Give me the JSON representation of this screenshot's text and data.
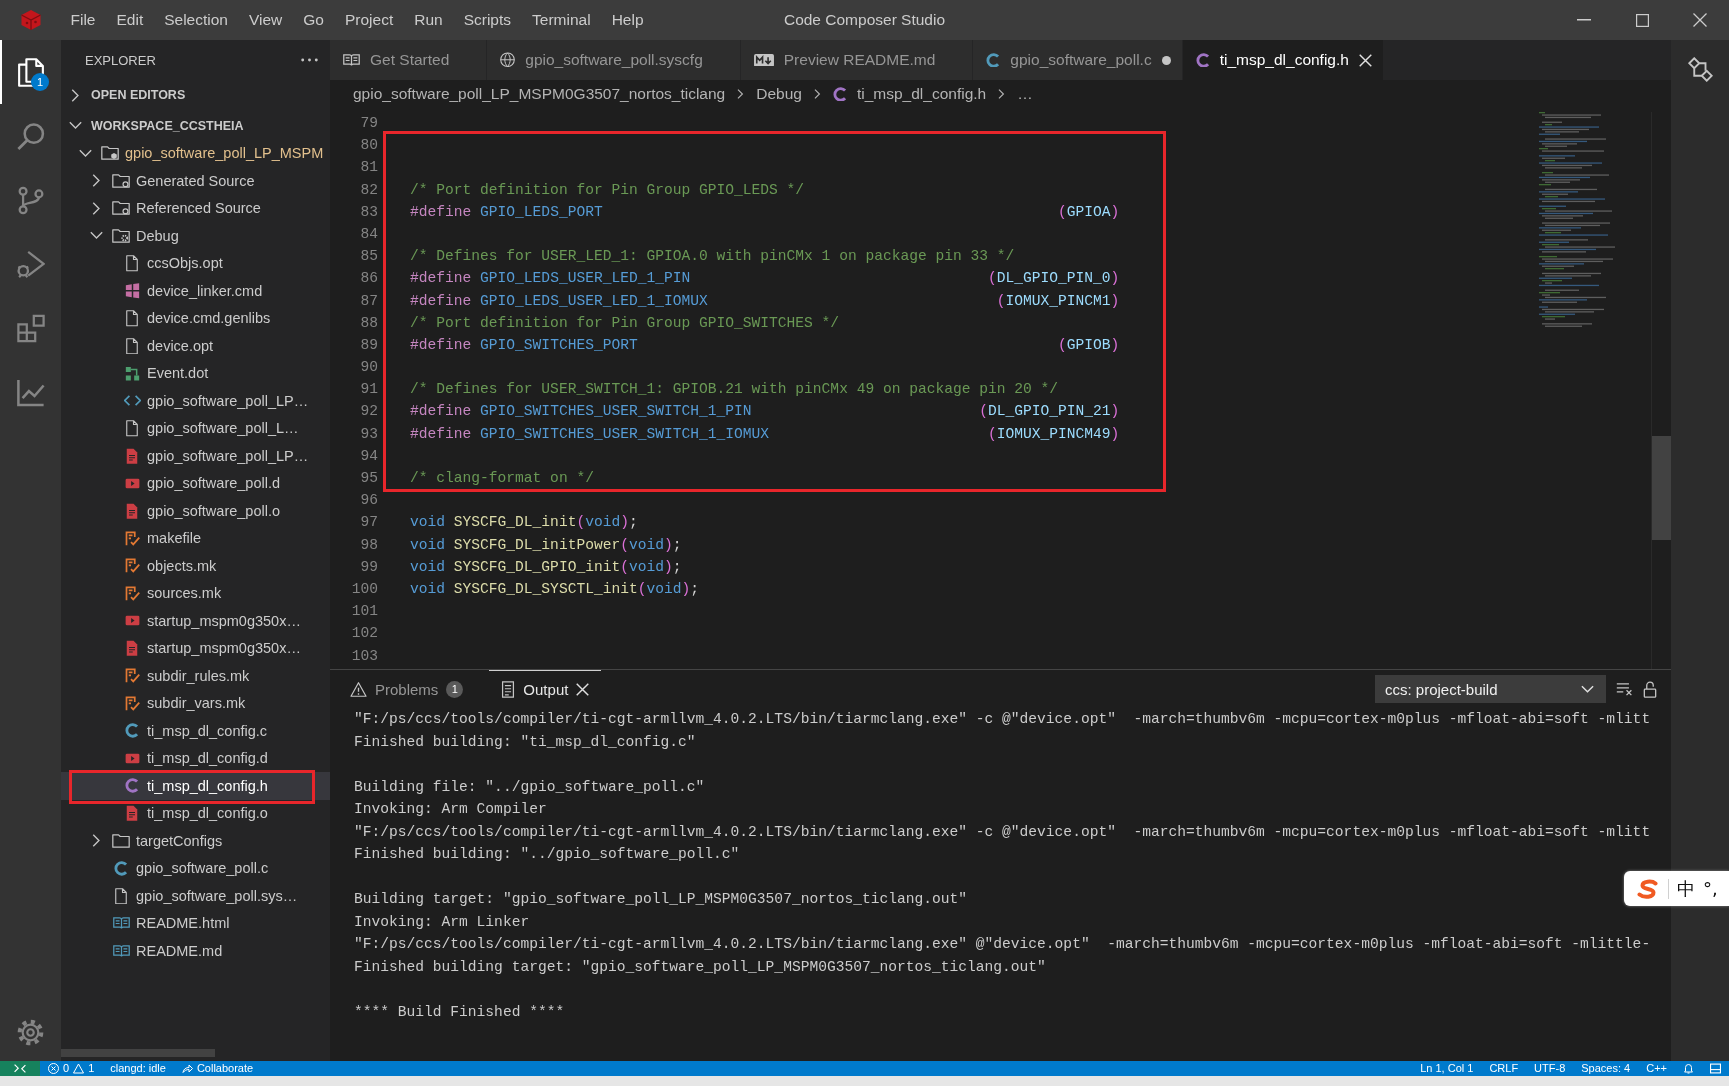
{
  "title_bar": {
    "menu": [
      "File",
      "Edit",
      "Selection",
      "View",
      "Go",
      "Project",
      "Run",
      "Scripts",
      "Terminal",
      "Help"
    ],
    "title": "Code Composer Studio"
  },
  "activity_bar": {
    "items": [
      {
        "kind": "explorer",
        "selected": true,
        "badge": "1"
      },
      {
        "kind": "search",
        "selected": false
      },
      {
        "kind": "source-control",
        "selected": false
      },
      {
        "kind": "run-debug",
        "selected": false
      },
      {
        "kind": "extensions",
        "selected": false
      },
      {
        "kind": "chart",
        "selected": false
      }
    ]
  },
  "explorer": {
    "title": "EXPLORER",
    "sections": [
      {
        "label": "OPEN EDITORS",
        "expanded": false
      },
      {
        "label": "WORKSPACE_CCSTHEIA",
        "expanded": true
      }
    ],
    "tree": [
      {
        "label": "gpio_software_poll_LP_MSPM",
        "kind": "project",
        "expanded": true,
        "selected": false,
        "annotated": false,
        "children": [
          {
            "label": "Generated Source",
            "kind": "source-folder",
            "expanded": false,
            "selected": false,
            "annotated": false
          },
          {
            "label": "Referenced Source",
            "kind": "source-folder",
            "expanded": false,
            "selected": false,
            "annotated": false
          },
          {
            "label": "Debug",
            "kind": "build-folder",
            "expanded": true,
            "selected": false,
            "annotated": false,
            "children": [
              {
                "label": "ccsObjs.opt",
                "kind": "text",
                "selected": false,
                "annotated": false
              },
              {
                "label": "device_linker.cmd",
                "kind": "cmd",
                "selected": false,
                "annotated": false
              },
              {
                "label": "device.cmd.genlibs",
                "kind": "text",
                "selected": false,
                "annotated": false
              },
              {
                "label": "device.opt",
                "kind": "text",
                "selected": false,
                "annotated": false
              },
              {
                "label": "Event.dot",
                "kind": "dot",
                "selected": false,
                "annotated": false
              },
              {
                "label": "gpio_software_poll_LP…",
                "kind": "xml",
                "selected": false,
                "annotated": false
              },
              {
                "label": "gpio_software_poll_L…",
                "kind": "text",
                "selected": false,
                "annotated": false
              },
              {
                "label": "gpio_software_poll_LP…",
                "kind": "binary",
                "selected": false,
                "annotated": false
              },
              {
                "label": "gpio_software_poll.d",
                "kind": "dep",
                "selected": false,
                "annotated": false
              },
              {
                "label": "gpio_software_poll.o",
                "kind": "binary",
                "selected": false,
                "annotated": false
              },
              {
                "label": "makefile",
                "kind": "make",
                "selected": false,
                "annotated": false
              },
              {
                "label": "objects.mk",
                "kind": "make",
                "selected": false,
                "annotated": false
              },
              {
                "label": "sources.mk",
                "kind": "make",
                "selected": false,
                "annotated": false
              },
              {
                "label": "startup_mspm0g350x…",
                "kind": "dep",
                "selected": false,
                "annotated": false
              },
              {
                "label": "startup_mspm0g350x…",
                "kind": "binary",
                "selected": false,
                "annotated": false
              },
              {
                "label": "subdir_rules.mk",
                "kind": "make",
                "selected": false,
                "annotated": false
              },
              {
                "label": "subdir_vars.mk",
                "kind": "make",
                "selected": false,
                "annotated": false
              },
              {
                "label": "ti_msp_dl_config.c",
                "kind": "c",
                "selected": false,
                "annotated": false
              },
              {
                "label": "ti_msp_dl_config.d",
                "kind": "dep",
                "selected": false,
                "annotated": false
              },
              {
                "label": "ti_msp_dl_config.h",
                "kind": "h",
                "selected": true,
                "annotated": true
              },
              {
                "label": "ti_msp_dl_config.o",
                "kind": "binary",
                "selected": false,
                "annotated": false
              }
            ]
          },
          {
            "label": "targetConfigs",
            "kind": "folder",
            "expanded": false,
            "selected": false,
            "annotated": false
          },
          {
            "label": "gpio_software_poll.c",
            "kind": "c",
            "selected": false,
            "annotated": false
          },
          {
            "label": "gpio_software_poll.sys…",
            "kind": "text",
            "selected": false,
            "annotated": false
          },
          {
            "label": "README.html",
            "kind": "book",
            "selected": false,
            "annotated": false
          },
          {
            "label": "README.md",
            "kind": "book",
            "selected": false,
            "annotated": false
          }
        ]
      }
    ]
  },
  "editor": {
    "tabs": [
      {
        "label": "Get Started",
        "kind": "start",
        "selected": false,
        "modified": false
      },
      {
        "label": "gpio_software_poll.syscfg",
        "kind": "syscfg",
        "selected": false,
        "modified": false
      },
      {
        "label": "Preview README.md",
        "kind": "preview",
        "selected": false,
        "modified": false
      },
      {
        "label": "gpio_software_poll.c",
        "kind": "c",
        "selected": false,
        "modified": true
      },
      {
        "label": "ti_msp_dl_config.h",
        "kind": "h",
        "selected": true,
        "modified": false
      }
    ],
    "breadcrumbs": [
      {
        "label": "gpio_software_poll_LP_MSPM0G3507_nortos_ticlang",
        "kind": "path"
      },
      {
        "label": "Debug",
        "kind": "path"
      },
      {
        "label": "ti_msp_dl_config.h",
        "kind": "h"
      },
      {
        "label": "…",
        "kind": "path"
      }
    ],
    "segments": [
      {
        "boxed": false,
        "lines": [
          {
            "number": "79",
            "kind": "blank"
          }
        ]
      },
      {
        "boxed": true,
        "lines": [
          {
            "number": "80",
            "kind": "blank"
          },
          {
            "number": "81",
            "kind": "blank"
          },
          {
            "number": "82",
            "kind": "code",
            "tokens": [
              {
                "kind": "comment",
                "text": "/* Port definition for Pin Group GPIO_LEDS */"
              }
            ]
          },
          {
            "number": "83",
            "kind": "define",
            "tokens": [
              {
                "kind": "directive",
                "text": "#define"
              },
              {
                "kind": "macro",
                "text": " GPIO_LEDS_PORT"
              }
            ],
            "value": [
              {
                "kind": "bracket",
                "text": "("
              },
              {
                "kind": "constant",
                "text": "GPIOA"
              },
              {
                "kind": "bracket",
                "text": ")"
              }
            ]
          },
          {
            "number": "84",
            "kind": "blank"
          },
          {
            "number": "85",
            "kind": "code",
            "tokens": [
              {
                "kind": "comment",
                "text": "/* Defines for USER_LED_1: GPIOA.0 with pinCMx 1 on package pin 33 */"
              }
            ]
          },
          {
            "number": "86",
            "kind": "define",
            "tokens": [
              {
                "kind": "directive",
                "text": "#define"
              },
              {
                "kind": "macro",
                "text": " GPIO_LEDS_USER_LED_1_PIN"
              }
            ],
            "value": [
              {
                "kind": "bracket",
                "text": "("
              },
              {
                "kind": "constant",
                "text": "DL_GPIO_PIN_0"
              },
              {
                "kind": "bracket",
                "text": ")"
              }
            ]
          },
          {
            "number": "87",
            "kind": "define",
            "tokens": [
              {
                "kind": "directive",
                "text": "#define"
              },
              {
                "kind": "macro",
                "text": " GPIO_LEDS_USER_LED_1_IOMUX"
              }
            ],
            "value": [
              {
                "kind": "bracket",
                "text": "("
              },
              {
                "kind": "constant",
                "text": "IOMUX_PINCM1"
              },
              {
                "kind": "bracket",
                "text": ")"
              }
            ]
          },
          {
            "number": "88",
            "kind": "code",
            "tokens": [
              {
                "kind": "comment",
                "text": "/* Port definition for Pin Group GPIO_SWITCHES */"
              }
            ]
          },
          {
            "number": "89",
            "kind": "define",
            "tokens": [
              {
                "kind": "directive",
                "text": "#define"
              },
              {
                "kind": "macro",
                "text": " GPIO_SWITCHES_PORT"
              }
            ],
            "value": [
              {
                "kind": "bracket",
                "text": "("
              },
              {
                "kind": "constant",
                "text": "GPIOB"
              },
              {
                "kind": "bracket",
                "text": ")"
              }
            ]
          },
          {
            "number": "90",
            "kind": "blank"
          },
          {
            "number": "91",
            "kind": "code",
            "tokens": [
              {
                "kind": "comment",
                "text": "/* Defines for USER_SWITCH_1: GPIOB.21 with pinCMx 49 on package pin 20 */"
              }
            ]
          },
          {
            "number": "92",
            "kind": "define",
            "tokens": [
              {
                "kind": "directive",
                "text": "#define"
              },
              {
                "kind": "macro",
                "text": " GPIO_SWITCHES_USER_SWITCH_1_PIN"
              }
            ],
            "value": [
              {
                "kind": "bracket",
                "text": "("
              },
              {
                "kind": "constant",
                "text": "DL_GPIO_PIN_21"
              },
              {
                "kind": "bracket",
                "text": ")"
              }
            ]
          },
          {
            "number": "93",
            "kind": "define",
            "tokens": [
              {
                "kind": "directive",
                "text": "#define"
              },
              {
                "kind": "macro",
                "text": " GPIO_SWITCHES_USER_SWITCH_1_IOMUX"
              }
            ],
            "value": [
              {
                "kind": "bracket",
                "text": "("
              },
              {
                "kind": "constant",
                "text": "IOMUX_PINCM49"
              },
              {
                "kind": "bracket",
                "text": ")"
              }
            ]
          },
          {
            "number": "94",
            "kind": "blank"
          },
          {
            "number": "95",
            "kind": "code",
            "tokens": [
              {
                "kind": "comment",
                "text": "/* clang-format on */"
              }
            ]
          }
        ]
      },
      {
        "boxed": false,
        "lines": [
          {
            "number": "96",
            "kind": "blank"
          },
          {
            "number": "97",
            "kind": "code",
            "tokens": [
              {
                "kind": "keyword",
                "text": "void"
              },
              {
                "kind": "function",
                "text": " SYSCFG_DL_init"
              },
              {
                "kind": "bracket",
                "text": "("
              },
              {
                "kind": "keyword",
                "text": "void"
              },
              {
                "kind": "bracket",
                "text": ")"
              },
              {
                "kind": "punct",
                "text": ";"
              }
            ]
          },
          {
            "number": "98",
            "kind": "code",
            "tokens": [
              {
                "kind": "keyword",
                "text": "void"
              },
              {
                "kind": "function",
                "text": " SYSCFG_DL_initPower"
              },
              {
                "kind": "bracket",
                "text": "("
              },
              {
                "kind": "keyword",
                "text": "void"
              },
              {
                "kind": "bracket",
                "text": ")"
              },
              {
                "kind": "punct",
                "text": ";"
              }
            ]
          },
          {
            "number": "99",
            "kind": "code",
            "tokens": [
              {
                "kind": "keyword",
                "text": "void"
              },
              {
                "kind": "function",
                "text": " SYSCFG_DL_GPIO_init"
              },
              {
                "kind": "bracket",
                "text": "("
              },
              {
                "kind": "keyword",
                "text": "void"
              },
              {
                "kind": "bracket",
                "text": ")"
              },
              {
                "kind": "punct",
                "text": ";"
              }
            ]
          },
          {
            "number": "100",
            "kind": "code",
            "tokens": [
              {
                "kind": "keyword",
                "text": "void"
              },
              {
                "kind": "function",
                "text": " SYSCFG_DL_SYSCTL_init"
              },
              {
                "kind": "bracket",
                "text": "("
              },
              {
                "kind": "keyword",
                "text": "void"
              },
              {
                "kind": "bracket",
                "text": ")"
              },
              {
                "kind": "punct",
                "text": ";"
              }
            ]
          },
          {
            "number": "101",
            "kind": "blank"
          },
          {
            "number": "102",
            "kind": "blank"
          },
          {
            "number": "103",
            "kind": "blank"
          }
        ]
      }
    ]
  },
  "panel": {
    "tabs": [
      {
        "label": "Problems",
        "kind": "problems",
        "badge": "1",
        "selected": false
      },
      {
        "label": "Output",
        "kind": "output",
        "selected": true
      }
    ],
    "channel": "ccs: project-build",
    "output": [
      [
        "\"F:/ps/ccs/tools/compiler/ti-cgt-armllvm_4.0.2.LTS/bin/tiarmclang.exe\" -c @\"device.opt\"  -march=thumbv6m -mcpu=cortex-m0plus -mfloat-abi=soft -mlitt",
        "Finished building: \"ti_msp_dl_config.c\""
      ],
      [
        "Building file: \"../gpio_software_poll.c\"",
        "Invoking: Arm Compiler",
        "\"F:/ps/ccs/tools/compiler/ti-cgt-armllvm_4.0.2.LTS/bin/tiarmclang.exe\" -c @\"device.opt\"  -march=thumbv6m -mcpu=cortex-m0plus -mfloat-abi=soft -mlitt",
        "Finished building: \"../gpio_software_poll.c\""
      ],
      [
        "Building target: \"gpio_software_poll_LP_MSPM0G3507_nortos_ticlang.out\"",
        "Invoking: Arm Linker",
        "\"F:/ps/ccs/tools/compiler/ti-cgt-armllvm_4.0.2.LTS/bin/tiarmclang.exe\" @\"device.opt\"  -march=thumbv6m -mcpu=cortex-m0plus -mfloat-abi=soft -mlittle-",
        "Finished building target: \"gpio_software_poll_LP_MSPM0G3507_nortos_ticlang.out\""
      ],
      [
        "**** Build Finished ****"
      ]
    ]
  },
  "ime_toolbar": {
    "mode": "中",
    "punctuation": "°,"
  },
  "status_bar": {
    "errors": "0",
    "warnings": "1",
    "left": [
      {
        "label": "clangd: idle",
        "kind": "text"
      },
      {
        "label": "Collaborate",
        "kind": "share"
      }
    ],
    "right": [
      "Ln 1, Col 1",
      "CRLF",
      "UTF-8",
      "Spaces: 4",
      "C++"
    ]
  }
}
